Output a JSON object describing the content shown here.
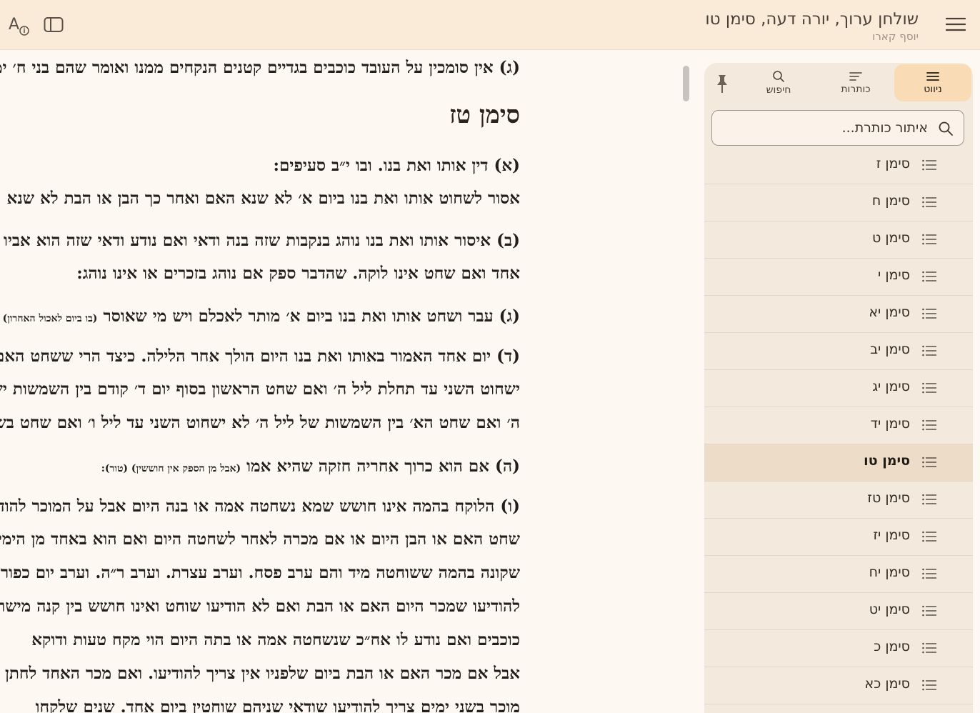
{
  "header": {
    "book_title": "שולחן ערוך, יורה דעה, סימן טו",
    "author": "יוסף קארו",
    "menu_icon": "hamburger-menu-icon",
    "sidebar_toggle_icon": "sidebar-toggle-icon",
    "font_settings_icon": "font-info-icon"
  },
  "content": {
    "lines": [
      {
        "text": "(ג) אין סומכין על העובד כוכבים בגדיים קטנים הנקחים ממנו ואומר שהם בני ח׳ ימים",
        "style": "bold"
      },
      {
        "text": "סימן טז",
        "style": "heading"
      },
      {
        "text": "(א) דין אותו ואת בנו. ובו י״ב סעיפים:",
        "style": "bold"
      },
      {
        "text": "אסור לשחוט אותו ואת בנו ביום א׳ לא שנא האם ואחר כך הבן או הבת לא שנא הבן ואחר כך האם",
        "style": "bold"
      },
      {
        "text": "(ב) איסור אותו ואת בנו נוהג בנקבות שזה בנה ודאי ואם נודע ודאי שזה הוא אביו נוהג אף בזכרים",
        "style": "bold"
      },
      {
        "text": "אחד ואם שחט אינו לוקה. שהדבר ספק אם נוהג בזכרים או אינו נוהג:",
        "style": "bold"
      },
      {
        "text": "(ג) עבר ושחט אותו ואת בנו ביום א׳ מותר לאכלם ויש מי שאוסר",
        "small": "(בו ביום לאכול האחרון)",
        "style": "bold"
      },
      {
        "text": "(ד) יום אחד האמור באותו ואת בנו היום הולך אחר הלילה. כיצד הרי ששחט האם בתחלת ליל ד׳",
        "style": "bold"
      },
      {
        "text": "ישחוט השני עד תחלת ליל ה׳ ואם שחט הראשון בסוף יום ד׳ קודם בין השמשות ישחוט השני בליל",
        "style": "bold"
      },
      {
        "text": "ה׳ ואם שחט הא׳ בין השמשות של ליל ה׳ לא ישחוט השני עד ליל ו׳ ואם שחט בשבת ישחוט",
        "style": "bold"
      },
      {
        "text": "(ה) אם הוא כרוך אחריה חזקה שהיא אמו",
        "small": "(אבל מן הספק אין חוששין) (טור):",
        "style": "bold"
      },
      {
        "text": "(ו) הלוקח בהמה אינו חושש שמא נשחטה אמה או בנה היום אבל על המוכר להודיע ללוקח אם",
        "style": "bold"
      },
      {
        "text": "שחט האם או הבן היום או אם מכרה לאחר לשחטה היום ואם הוא באחד מן הימים",
        "style": "bold"
      },
      {
        "text": "שקונה בהמה ששוחטה מיד והם ערב פסח. וערב עצרת. וערב ר״ה. וערב יום כפור",
        "style": "bold"
      },
      {
        "text": "להודיעו שמכר היום האם או הבת ואם לא הודיעו שוחט ואינו חושש בין קנה מישראל",
        "style": "bold"
      },
      {
        "text": "כוכבים ואם נודע לו אח״כ שנשחטה אמה או בתה היום הוי מקח טעות ודוקא",
        "style": "bold"
      },
      {
        "text": "אבל אם מכר האם או הבת ביום שלפניו אין צריך להודיעו. ואם מכר האחד לחתן",
        "style": "bold"
      },
      {
        "text": "מוכר בשני ימים צריך להודיעו שודאי שניהם שוחטין ביום אחד. שנים שלקחו",
        "style": "bold"
      }
    ]
  },
  "sidebar": {
    "tabs": [
      {
        "label": "ניווט",
        "icon": "list-lines-icon",
        "active": true
      },
      {
        "label": "כותרות",
        "icon": "headings-icon",
        "active": false
      },
      {
        "label": "חיפוש",
        "icon": "search-icon",
        "active": false
      }
    ],
    "pin_icon": "pin-icon",
    "search": {
      "placeholder": "איתור כותרת...",
      "value": ""
    },
    "items": [
      {
        "label": "סימן ז",
        "selected": false
      },
      {
        "label": "סימן ח",
        "selected": false
      },
      {
        "label": "סימן ט",
        "selected": false
      },
      {
        "label": "סימן י",
        "selected": false
      },
      {
        "label": "סימן יא",
        "selected": false
      },
      {
        "label": "סימן יב",
        "selected": false
      },
      {
        "label": "סימן יג",
        "selected": false
      },
      {
        "label": "סימן יד",
        "selected": false
      },
      {
        "label": "סימן טו",
        "selected": true
      },
      {
        "label": "סימן טז",
        "selected": false
      },
      {
        "label": "סימן יז",
        "selected": false
      },
      {
        "label": "סימן יח",
        "selected": false
      },
      {
        "label": "סימן יט",
        "selected": false
      },
      {
        "label": "סימן כ",
        "selected": false
      },
      {
        "label": "סימן כא",
        "selected": false
      }
    ]
  }
}
